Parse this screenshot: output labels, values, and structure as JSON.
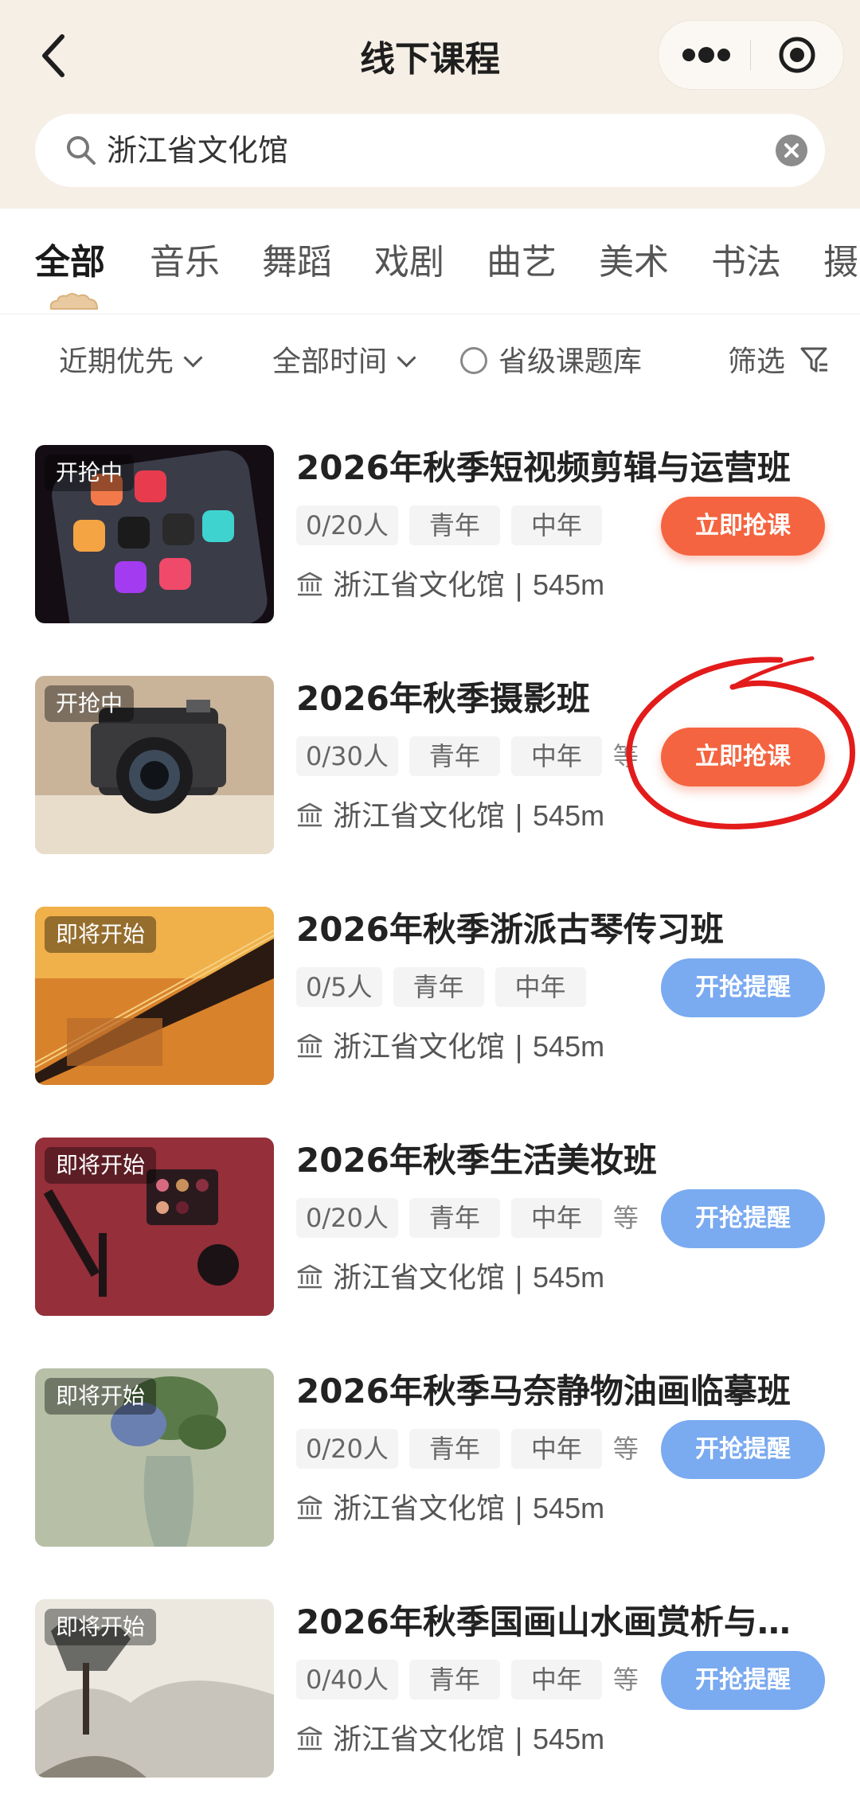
{
  "header": {
    "title": "线下课程",
    "search_text": "浙江省文化馆"
  },
  "tabs": [
    "全部",
    "音乐",
    "舞蹈",
    "戏剧",
    "曲艺",
    "美术",
    "书法",
    "摄"
  ],
  "filters": {
    "sort": "近期优先",
    "time": "全部时间",
    "library": "省级课题库",
    "screen": "筛选"
  },
  "courses": [
    {
      "status": "开抢中",
      "title": "2026年秋季短视频剪辑与运营班",
      "quota": "0/20人",
      "tags": [
        "青年",
        "中年"
      ],
      "more": "",
      "venue": "浙江省文化馆",
      "distance": "545m",
      "action": "立即抢课",
      "action_type": "grab"
    },
    {
      "status": "开抢中",
      "title": "2026年秋季摄影班",
      "quota": "0/30人",
      "tags": [
        "青年",
        "中年"
      ],
      "more": "等",
      "venue": "浙江省文化馆",
      "distance": "545m",
      "action": "立即抢课",
      "action_type": "grab"
    },
    {
      "status": "即将开始",
      "title": "2026年秋季浙派古琴传习班",
      "quota": "0/5人",
      "tags": [
        "青年",
        "中年"
      ],
      "more": "",
      "venue": "浙江省文化馆",
      "distance": "545m",
      "action": "开抢提醒",
      "action_type": "remind"
    },
    {
      "status": "即将开始",
      "title": "2026年秋季生活美妆班",
      "quota": "0/20人",
      "tags": [
        "青年",
        "中年"
      ],
      "more": "等",
      "venue": "浙江省文化馆",
      "distance": "545m",
      "action": "开抢提醒",
      "action_type": "remind"
    },
    {
      "status": "即将开始",
      "title": "2026年秋季马奈静物油画临摹班",
      "quota": "0/20人",
      "tags": [
        "青年",
        "中年"
      ],
      "more": "等",
      "venue": "浙江省文化馆",
      "distance": "545m",
      "action": "开抢提醒",
      "action_type": "remind"
    },
    {
      "status": "即将开始",
      "title": "2026年秋季国画山水画赏析与…",
      "quota": "0/40人",
      "tags": [
        "青年",
        "中年"
      ],
      "more": "等",
      "venue": "浙江省文化馆",
      "distance": "545m",
      "action": "开抢提醒",
      "action_type": "remind"
    }
  ],
  "colors": {
    "header_bg": "#f5efe6",
    "grab_button": "#f46440",
    "remind_button": "#7aaaf0",
    "annotation_circle": "#e31b1b"
  }
}
